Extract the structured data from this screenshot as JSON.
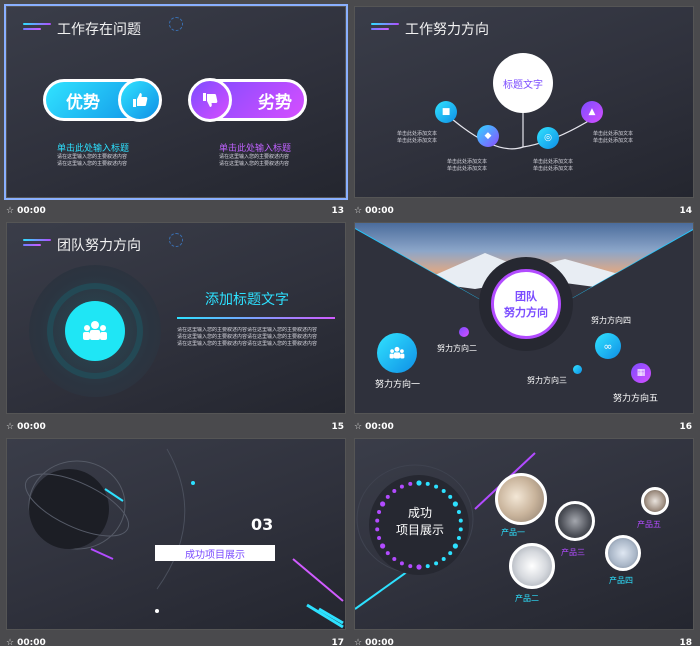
{
  "slides": [
    {
      "num": "13",
      "timing": "00:00",
      "title": "工作存在问题",
      "adv_label": "优势",
      "disadv_label": "劣势",
      "left_heading": "单击此处输入标题",
      "left_lines": [
        "请在这里输入您的主要叙述内容",
        "请在这里输入您的主要叙述内容"
      ],
      "right_heading": "单击此处输入标题",
      "right_lines": [
        "请在这里输入您的主要叙述内容",
        "请在这里输入您的主要叙述内容"
      ]
    },
    {
      "num": "14",
      "timing": "00:00",
      "title": "工作努力方向",
      "center": "标题文字",
      "note": "单击此处添加文本"
    },
    {
      "num": "15",
      "timing": "00:00",
      "title": "团队努力方向",
      "heading": "添加标题文字",
      "lines": [
        "请在这里输入您的主要叙述内容请在这里输入您的主要叙述内容",
        "请在这里输入您的主要叙述内容请在这里输入您的主要叙述内容",
        "请在这里输入您的主要叙述内容请在这里输入您的主要叙述内容"
      ]
    },
    {
      "num": "16",
      "timing": "00:00",
      "center_line1": "团队",
      "center_line2": "努力方向",
      "dirs": [
        "努力方向一",
        "努力方向二",
        "努力方向三",
        "努力方向四",
        "努力方向五"
      ]
    },
    {
      "num": "17",
      "timing": "00:00",
      "section_no": "03",
      "section_title": "成功项目展示"
    },
    {
      "num": "18",
      "timing": "00:00",
      "center_line1": "成功",
      "center_line2": "项目展示",
      "products": [
        "产品一",
        "产品二",
        "产品三",
        "产品四",
        "产品五"
      ]
    }
  ],
  "colors": {
    "cyan": "#2de1ff",
    "purple": "#b24bff",
    "panel": "#2f313c"
  },
  "icons": [
    "thumbs-up-icon",
    "thumbs-down-icon",
    "team-icon"
  ]
}
